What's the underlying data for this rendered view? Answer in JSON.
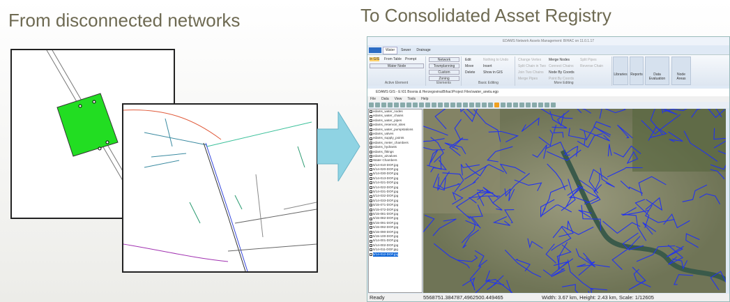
{
  "slide": {
    "left_heading": "From disconnected networks",
    "right_heading": "To Consolidated Asset Registry"
  },
  "colors": {
    "heading": "#6e6a52",
    "arrow": "#8fd3e3",
    "building": "#22dd22",
    "pipe": "#2233ee"
  },
  "ribbon": {
    "title": "EDAMS Network Assets Management: BIHAC on 11.0.1.17",
    "tabs": [
      "Water",
      "Sewer",
      "Drainage"
    ],
    "active_element": {
      "buttons": [
        "In GIS",
        "From Table",
        "Prompt"
      ],
      "dropdown": "Water Node",
      "label": "Active Element"
    },
    "elements": {
      "dropdowns": [
        "Network",
        "Townplanning",
        "Custom",
        "Zoning"
      ],
      "label": "Elements"
    },
    "basic_editing": {
      "buttons": [
        "Edit",
        "Move",
        "Delete",
        "Nothing to Undo",
        "Insert",
        "Show in GIS"
      ],
      "label": "Basic Editing"
    },
    "more_editing": {
      "buttons": [
        "Change Vertex",
        "Split Chain in Two",
        "Join Two Chains",
        "Merge Pipes",
        "Merge Nodes",
        "Connect Chains",
        "Node By Coords",
        "Point By Coords",
        "Split Pipes",
        "Reverse Chain"
      ],
      "label": "More Editing"
    },
    "big_buttons": [
      "Libraries",
      "Reports",
      "Data Evaluation",
      "Node Areas"
    ]
  },
  "gis": {
    "title": "EDAMS GIS - E:\\01 Bosnia & Herzegovina\\Bihac\\Project Files\\water_anela.egp",
    "menu": [
      "File",
      "Data",
      "View",
      "Tools",
      "Help"
    ],
    "layers": [
      "edams_water_nodes",
      "edams_water_chains",
      "edams_water_pipes",
      "edams_reservoir_sites",
      "edams_water_pumpstations",
      "edams_valves",
      "edams_supply_points",
      "edams_meter_chambers",
      "edams_hydrants",
      "edams_fittings",
      "edams_airvalves",
      "Water Chambers",
      "5/14-010-DOF.jpg",
      "5/14-020-DOF.jpg",
      "5/14-030-DOF.jpg",
      "5/14-013-DOF.jpg",
      "5/14-021-DOF.jpg",
      "5/14-022-DOF.jpg",
      "5/14-031-DOF.jpg",
      "5/14-032-DOF.jpg",
      "5/14-033-DOF.jpg",
      "5/15-071-DOF.jpg",
      "5/15-072-DOF.jpg",
      "5/15-081-DOF.jpg",
      "5/15-082-DOF.jpg",
      "5/15-091-DOF.jpg",
      "5/15-092-DOF.jpg",
      "5/15-090-DOF.jpg",
      "5/15-100-DOF.jpg",
      "5/14-001-DOF.jpg",
      "5/14-002-DOF.jpg",
      "5/14-011-DOF.jpg",
      "5/14-012-DOF.jpg"
    ],
    "selected_layer": "5/14-012-DOF.jpg",
    "status": {
      "ready": "Ready",
      "coords": "5568751.384787,4962500.449465",
      "extent": "Width: 3.67 km, Height: 2.43 km, Scale: 1/12605"
    }
  }
}
